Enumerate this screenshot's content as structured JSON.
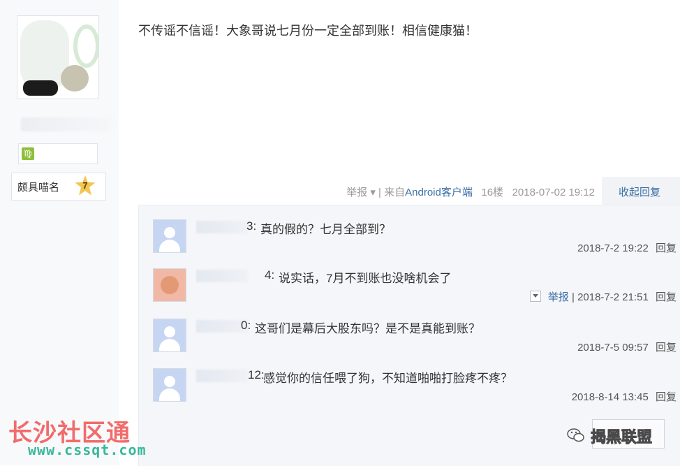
{
  "sidebar": {
    "rank_label": "颇具喵名",
    "rank_level": "7",
    "zodiac_icon_glyph": "♍"
  },
  "post": {
    "text": "不传谣不信谣！大象哥说七月份一定全部到账！相信健康猫！",
    "report": "举报",
    "separator": "|",
    "from_label": "来自",
    "client": "Android客户端",
    "floor": "16楼",
    "datetime": "2018-07-02 19:12",
    "collapse_label": "收起回复"
  },
  "replies": [
    {
      "name_suffix": "3:",
      "text": "真的假的？七月全部到？",
      "datetime": "2018-7-2 19:22",
      "reply_label": "回复"
    },
    {
      "name_suffix": "4:",
      "text": "说实话，7月不到账也没啥机会了",
      "report": "举报",
      "datetime": "2018-7-2 21:51",
      "reply_label": "回复"
    },
    {
      "name_suffix": "0:",
      "text": "这哥们是幕后大股东吗？是不是真能到账？",
      "datetime": "2018-7-5 09:57",
      "reply_label": "回复"
    },
    {
      "name_suffix": "12:",
      "text": "感觉你的信任喂了狗，不知道啪啪打脸疼不疼？",
      "datetime": "2018-8-14 13:45",
      "reply_label": "回复"
    }
  ],
  "watermarks": {
    "site_name": "长沙社区通",
    "site_url": "www.cssqt.com",
    "account": "揭黑联盟"
  },
  "colors": {
    "link": "#3a6ea5",
    "watermark_red": "#f26b6b",
    "watermark_green": "#39b89a"
  }
}
